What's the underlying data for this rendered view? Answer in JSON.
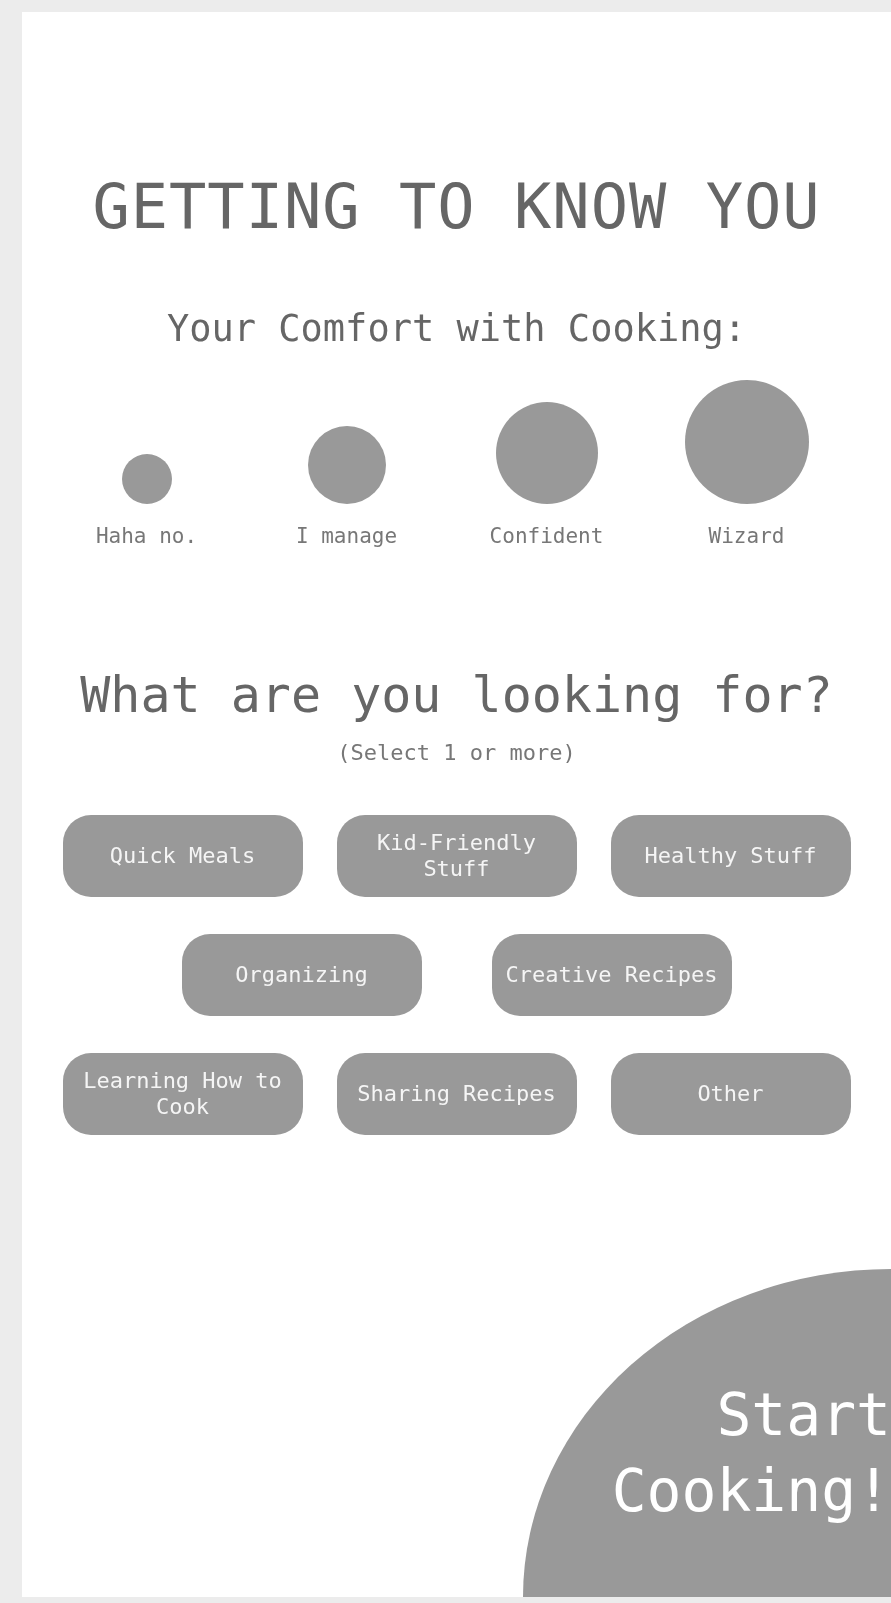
{
  "title": "GETTING TO KNOW YOU",
  "comfort": {
    "heading": "Your Comfort with Cooking:",
    "options": [
      {
        "label": "Haha no."
      },
      {
        "label": "I manage"
      },
      {
        "label": "Confident"
      },
      {
        "label": "Wizard"
      }
    ]
  },
  "interests": {
    "heading": "What are you looking for?",
    "hint": "(Select 1 or more)",
    "rows": [
      [
        "Quick Meals",
        "Kid-Friendly Stuff",
        "Healthy Stuff"
      ],
      [
        "Organizing",
        "Creative Recipes"
      ],
      [
        "Learning How to Cook",
        "Sharing Recipes",
        "Other"
      ]
    ]
  },
  "start_button": {
    "lines": [
      "Start",
      "Cooking!"
    ]
  }
}
